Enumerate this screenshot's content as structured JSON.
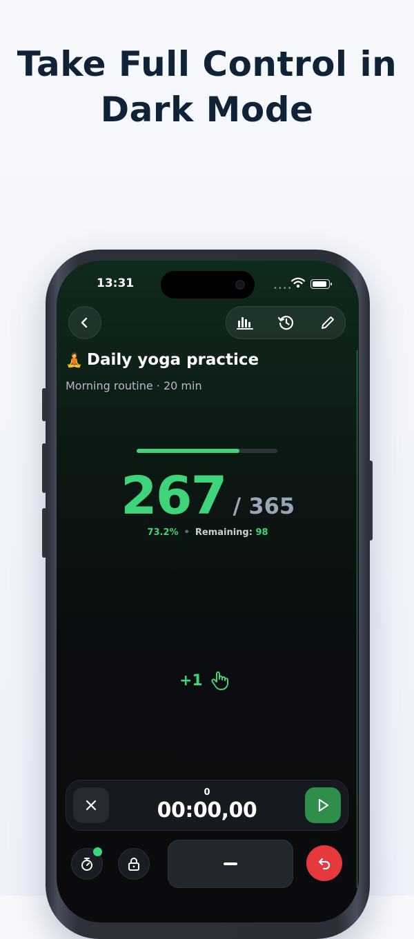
{
  "headline": "Take Full Control in Dark Mode",
  "status_bar": {
    "time": "13:31",
    "signal": "••••"
  },
  "header": {
    "back_icon": "chevron-left-icon",
    "tools": [
      "bar-chart-icon",
      "history-icon",
      "pencil-icon"
    ]
  },
  "goal": {
    "emoji": "🧘",
    "title": "Daily yoga practice",
    "subtitle": "Morning routine · 20 min"
  },
  "counter": {
    "current": "267",
    "total": "/ 365",
    "progress_fraction": 0.732,
    "percent": "73.2%",
    "remaining_label": "Remaining:",
    "remaining_value": "98",
    "separator": "•"
  },
  "increment": {
    "label": "+1",
    "icon": "tap-hand-icon"
  },
  "timer": {
    "lap": "0",
    "value": "00:00,00",
    "close_icon": "close-icon",
    "play_icon": "play-icon"
  },
  "bottom_bar": {
    "stopwatch_icon": "stopwatch-icon",
    "lock_icon": "lock-icon",
    "minus_icon": "minus-icon",
    "undo_icon": "undo-icon"
  },
  "colors": {
    "accent": "#3ed47a",
    "play_button": "#2f8f4a",
    "undo_button": "#e5393e",
    "headline": "#0f2236"
  }
}
